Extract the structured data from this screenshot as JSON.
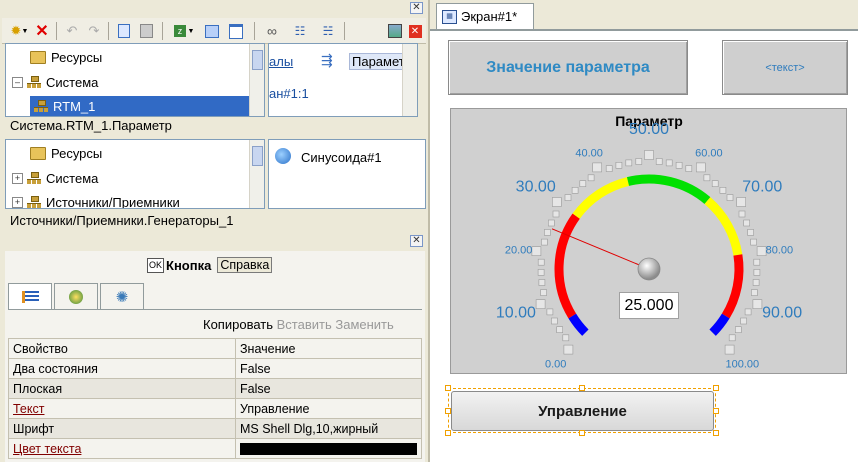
{
  "project_tree": {
    "items": [
      "Ресурсы",
      "Система",
      "RTM_1"
    ],
    "right_items": [
      "алы",
      "Параметр",
      "ан#1:1"
    ],
    "path": "Система.RTM_1.Параметр"
  },
  "sources_tree": {
    "items": [
      "Ресурсы",
      "Система",
      "Источники/Приемники"
    ],
    "right_items": [
      "Синусоида#1"
    ],
    "path": "Источники/Приемники.Генераторы_1"
  },
  "properties": {
    "object_icon_text": "OK",
    "object_type": "Кнопка",
    "help_button": "Справка",
    "actions": {
      "copy": "Копировать",
      "paste": "Вставить",
      "replace": "Заменить"
    },
    "columns": [
      "Свойство",
      "Значение"
    ],
    "rows": [
      {
        "name": "Два состояния",
        "value": "False"
      },
      {
        "name": "Плоская",
        "value": "False"
      },
      {
        "name": "Текст",
        "value": "Управление"
      },
      {
        "name": "Шрифт",
        "value": "MS Shell Dlg,10,жирный"
      },
      {
        "name": "Цвет текста",
        "value": ""
      }
    ],
    "text_color": "#000000"
  },
  "screen": {
    "tab_title": "Экран#1*",
    "param_value_label": "Значение параметра",
    "text_placeholder": "<текст>",
    "control_button": "Управление"
  },
  "gauge": {
    "title": "Параметр",
    "value": 25,
    "value_text": "25.000",
    "min": 0,
    "max": 100,
    "major_ticks": [
      "0.00",
      "10.00",
      "20.00",
      "30.00",
      "40.00",
      "50.00",
      "60.00",
      "70.00",
      "80.00",
      "90.00",
      "100.00"
    ],
    "zones": [
      {
        "from": 0,
        "to": 5,
        "color": "#0000ff"
      },
      {
        "from": 5,
        "to": 30,
        "color": "#ff0000"
      },
      {
        "from": 30,
        "to": 45,
        "color": "#ffff00"
      },
      {
        "from": 45,
        "to": 65,
        "color": "#00e000"
      },
      {
        "from": 65,
        "to": 80,
        "color": "#ffff00"
      },
      {
        "from": 80,
        "to": 95,
        "color": "#ff0000"
      },
      {
        "from": 95,
        "to": 100,
        "color": "#0000ff"
      }
    ]
  }
}
